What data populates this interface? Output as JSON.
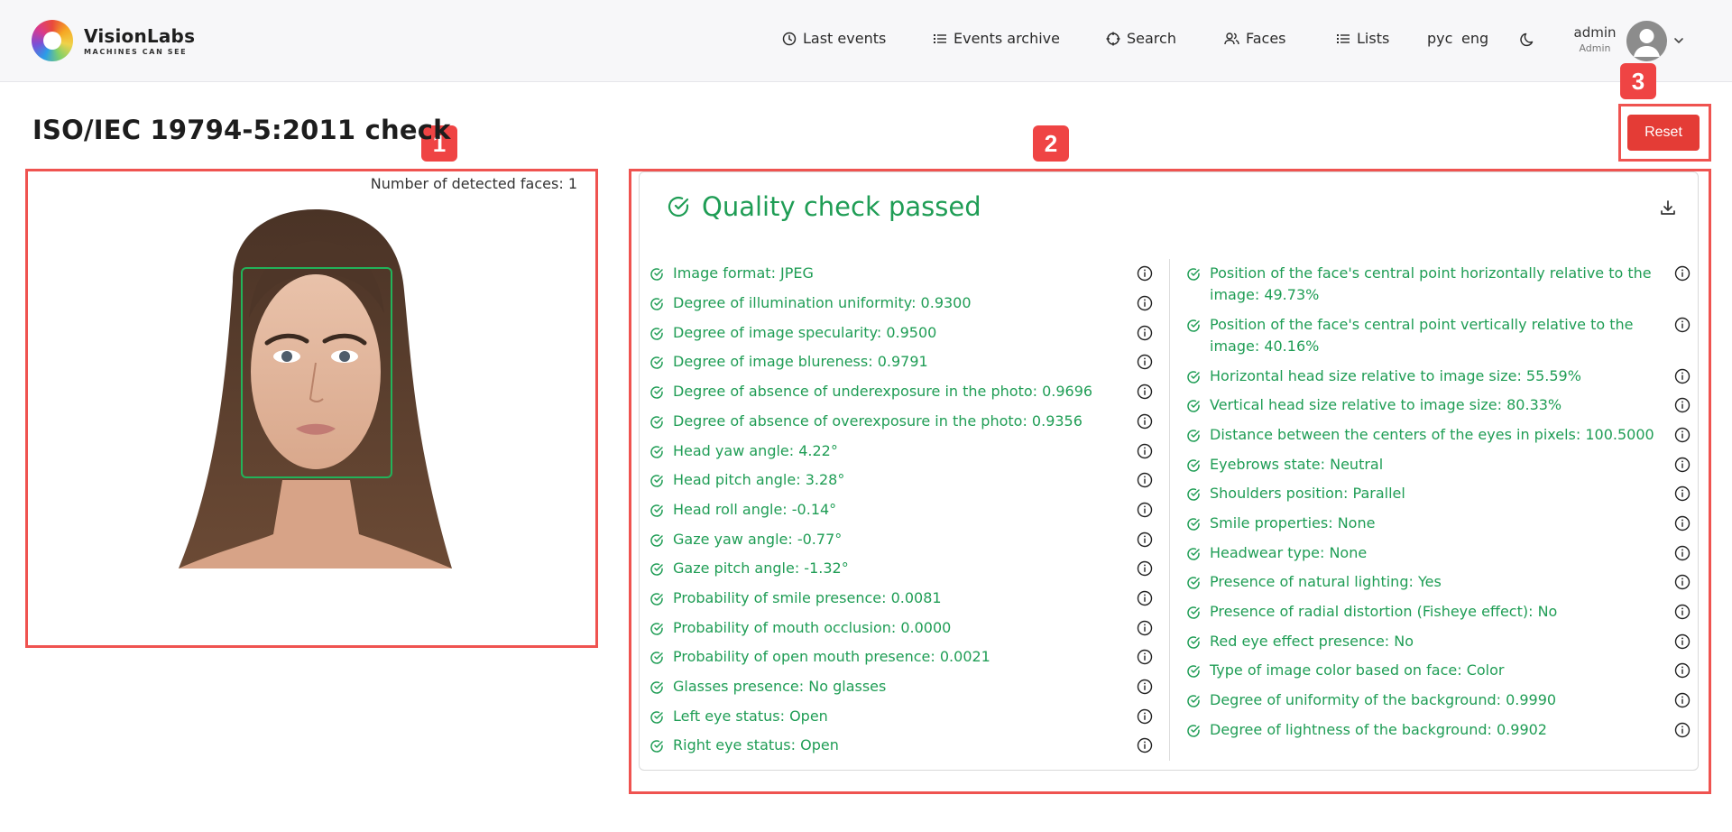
{
  "brand": {
    "name": "VisionLabs",
    "tagline": "MACHINES CAN SEE"
  },
  "nav": {
    "items": [
      {
        "label": "Last events",
        "icon": "clock-icon"
      },
      {
        "label": "Events archive",
        "icon": "list-icon"
      },
      {
        "label": "Search",
        "icon": "target-icon"
      },
      {
        "label": "Faces",
        "icon": "users-icon"
      },
      {
        "label": "Lists",
        "icon": "list-icon"
      }
    ],
    "lang_ru": "рус",
    "lang_en": "eng",
    "theme_icon": "moon-icon"
  },
  "user": {
    "name": "admin",
    "role": "Admin"
  },
  "page": {
    "title": "ISO/IEC 19794-5:2011 check",
    "reset_label": "Reset",
    "faces_count": "Number of detected faces: 1"
  },
  "badges": [
    "1",
    "2",
    "3"
  ],
  "quality": {
    "status": "Quality check passed",
    "status_color": "#1f9d55",
    "left_checks": [
      "Image format: JPEG",
      "Degree of illumination uniformity: 0.9300",
      "Degree of image specularity: 0.9500",
      "Degree of image blureness: 0.9791",
      "Degree of absence of underexposure in the photo: 0.9696",
      "Degree of absence of overexposure in the photo: 0.9356",
      "Head yaw angle: 4.22°",
      "Head pitch angle: 3.28°",
      "Head roll angle: -0.14°",
      "Gaze yaw angle: -0.77°",
      "Gaze pitch angle: -1.32°",
      "Probability of smile presence: 0.0081",
      "Probability of mouth occlusion: 0.0000",
      "Probability of open mouth presence: 0.0021",
      "Glasses presence: No glasses",
      "Left eye status: Open",
      "Right eye status: Open"
    ],
    "right_checks": [
      "Position of the face's central point horizontally relative to the image: 49.73%",
      "Position of the face's central point vertically relative to the image: 40.16%",
      "Horizontal head size relative to image size: 55.59%",
      "Vertical head size relative to image size: 80.33%",
      "Distance between the centers of the eyes in pixels: 100.5000",
      "Eyebrows state: Neutral",
      "Shoulders position: Parallel",
      "Smile properties: None",
      "Headwear type: None",
      "Presence of natural lighting: Yes",
      "Presence of radial distortion (Fisheye effect): No",
      "Red eye effect presence: No",
      "Type of image color based on face: Color",
      "Degree of uniformity of the background: 0.9990",
      "Degree of lightness of the background: 0.9902"
    ]
  },
  "colors": {
    "accent_red": "#e43c36",
    "highlight": "#ef5350",
    "pass_green": "#1f9d55"
  }
}
